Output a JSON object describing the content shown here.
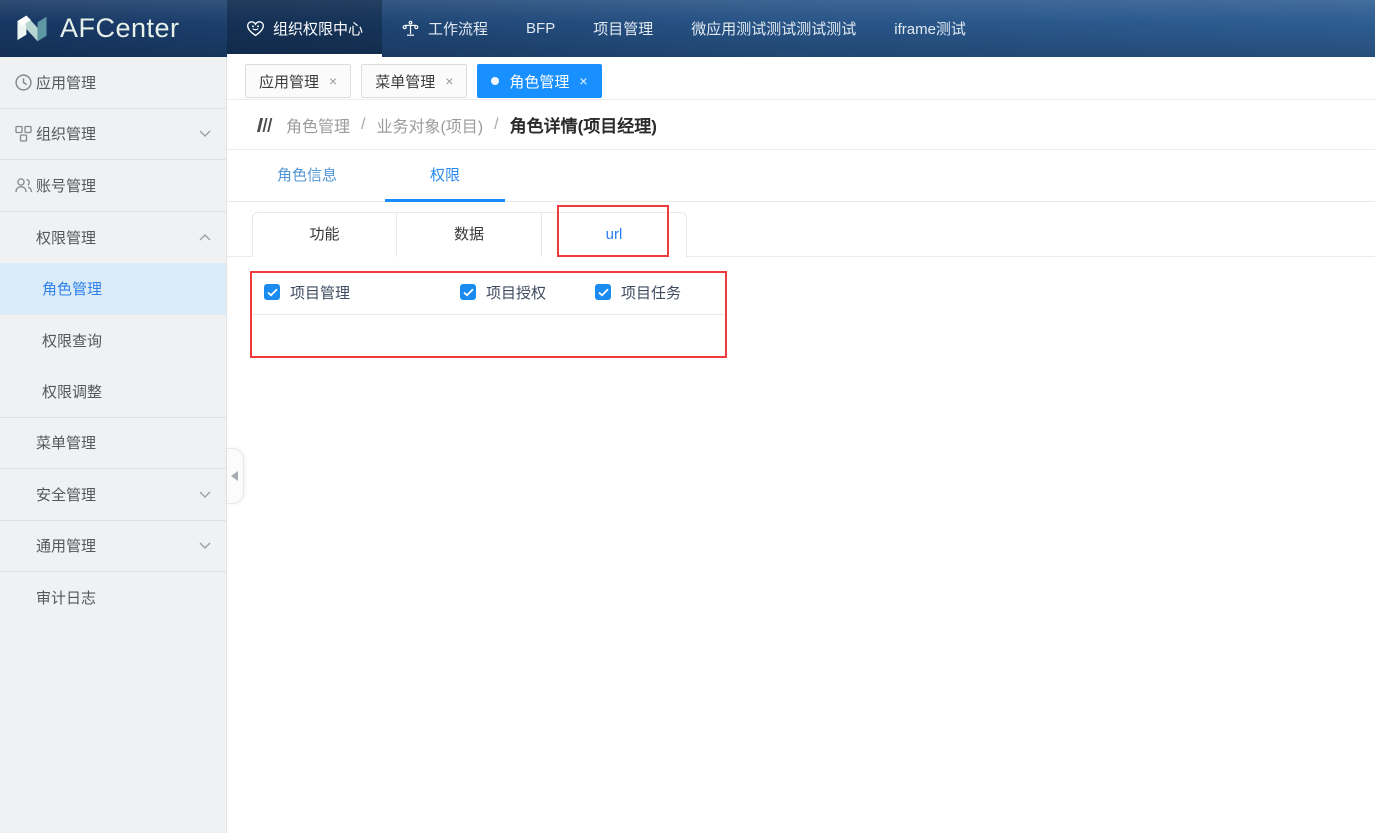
{
  "app": {
    "name": "AFCenter"
  },
  "topnav": {
    "items": [
      {
        "label": "组织权限中心",
        "icon": "heart-smile-icon",
        "active": true
      },
      {
        "label": "工作流程",
        "icon": "scale-icon",
        "active": false
      },
      {
        "label": "BFP",
        "active": false
      },
      {
        "label": "项目管理",
        "active": false
      },
      {
        "label": "微应用测试测试测试测试",
        "active": false
      },
      {
        "label": "iframe测试",
        "active": false
      }
    ]
  },
  "sidebar": {
    "items": [
      {
        "label": "应用管理",
        "icon": "clock-icon",
        "level": 1
      },
      {
        "label": "组织管理",
        "icon": "org-icon",
        "level": 1,
        "chevron": "down"
      },
      {
        "label": "账号管理",
        "icon": "users-icon",
        "level": 1
      },
      {
        "label": "权限管理",
        "level": 1,
        "chevron": "up",
        "expanded": true
      },
      {
        "label": "角色管理",
        "level": 2,
        "active": true
      },
      {
        "label": "权限查询",
        "level": 2
      },
      {
        "label": "权限调整",
        "level": 2
      },
      {
        "label": "菜单管理",
        "level": 1
      },
      {
        "label": "安全管理",
        "level": 1,
        "chevron": "down"
      },
      {
        "label": "通用管理",
        "level": 1,
        "chevron": "down"
      },
      {
        "label": "审计日志",
        "level": 1
      }
    ]
  },
  "workspace_tabs": {
    "close_glyph": "×",
    "items": [
      {
        "label": "应用管理",
        "active": false
      },
      {
        "label": "菜单管理",
        "active": false
      },
      {
        "label": "角色管理",
        "active": true
      }
    ]
  },
  "breadcrumb": {
    "separator": "/",
    "items": [
      {
        "label": "角色管理"
      },
      {
        "label": "业务对象(项目)"
      },
      {
        "label": "角色详情(项目经理)",
        "current": true
      }
    ]
  },
  "detail_tabs": {
    "items": [
      {
        "label": "角色信息",
        "active": false
      },
      {
        "label": "权限",
        "active": true
      }
    ]
  },
  "permission_tabs": {
    "items": [
      {
        "label": "功能",
        "active": false
      },
      {
        "label": "数据",
        "active": false
      },
      {
        "label": "url",
        "active": true
      }
    ]
  },
  "url_permissions": {
    "options": [
      {
        "label": "项目管理",
        "checked": true
      },
      {
        "label": "项目授权",
        "checked": true
      },
      {
        "label": "项目任务",
        "checked": true
      }
    ]
  },
  "colors": {
    "accent": "#1890ff",
    "navbar_gradient_left": "#173763",
    "navbar_gradient_right": "#2e5d92",
    "sidebar_bg": "#f0f1f2",
    "sidebar_active_bg": "#dcebf8",
    "sidebar_active_text": "#2e82ea",
    "annotation_red": "#ee3b3b",
    "checkbox_blue": "#1b8bf0"
  }
}
